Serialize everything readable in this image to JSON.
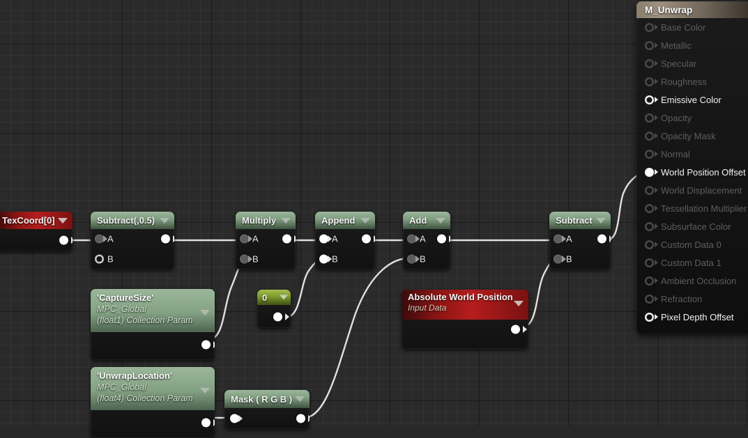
{
  "material_node": {
    "title": "M_Unwrap",
    "outputs": [
      {
        "label": "Base Color",
        "connected": false,
        "filled": false
      },
      {
        "label": "Metallic",
        "connected": false,
        "filled": false
      },
      {
        "label": "Specular",
        "connected": false,
        "filled": false
      },
      {
        "label": "Roughness",
        "connected": false,
        "filled": false
      },
      {
        "label": "Emissive Color",
        "connected": true,
        "filled": false
      },
      {
        "label": "Opacity",
        "connected": false,
        "filled": false
      },
      {
        "label": "Opacity Mask",
        "connected": false,
        "filled": false
      },
      {
        "label": "Normal",
        "connected": false,
        "filled": false
      },
      {
        "label": "World Position Offset",
        "connected": true,
        "filled": true
      },
      {
        "label": "World Displacement",
        "connected": false,
        "filled": false
      },
      {
        "label": "Tessellation Multiplier",
        "connected": false,
        "filled": false
      },
      {
        "label": "Subsurface Color",
        "connected": false,
        "filled": false
      },
      {
        "label": "Custom Data 0",
        "connected": false,
        "filled": false
      },
      {
        "label": "Custom Data 1",
        "connected": false,
        "filled": false
      },
      {
        "label": "Ambient Occlusion",
        "connected": false,
        "filled": false
      },
      {
        "label": "Refraction",
        "connected": false,
        "filled": false
      },
      {
        "label": "Pixel Depth Offset",
        "connected": true,
        "filled": false
      }
    ]
  },
  "nodes": {
    "texcoord": {
      "title": "TexCoord[0]"
    },
    "subtract_half": {
      "title": "Subtract(,0.5)",
      "in_a": "A",
      "in_b": "B"
    },
    "capture_size": {
      "name": "'CaptureSize'",
      "collection": "MPC_Global",
      "type": "(float1) Collection Param"
    },
    "unwrap_location": {
      "name": "'UnwrapLocation'",
      "collection": "MPC_Global",
      "type": "(float4) Collection Param"
    },
    "multiply": {
      "title": "Multiply",
      "in_a": "A",
      "in_b": "B"
    },
    "constant_zero": {
      "title": "0"
    },
    "mask": {
      "title": "Mask ( R G B )"
    },
    "append": {
      "title": "Append",
      "in_a": "A",
      "in_b": "B"
    },
    "add": {
      "title": "Add",
      "in_a": "A",
      "in_b": "B"
    },
    "abs_world_position": {
      "title": "Absolute World Position",
      "subtitle": "Input Data"
    },
    "subtract": {
      "title": "Subtract",
      "in_a": "A",
      "in_b": "B"
    }
  },
  "colors": {
    "canvas": "#2a2a2a",
    "node_body": "#111111",
    "header_green": "#7e9c7e",
    "header_green_bright": "#7d9a2c",
    "header_red": "#b51d1d",
    "header_tan": "#9d9080",
    "wire": "#e0e0e0"
  }
}
